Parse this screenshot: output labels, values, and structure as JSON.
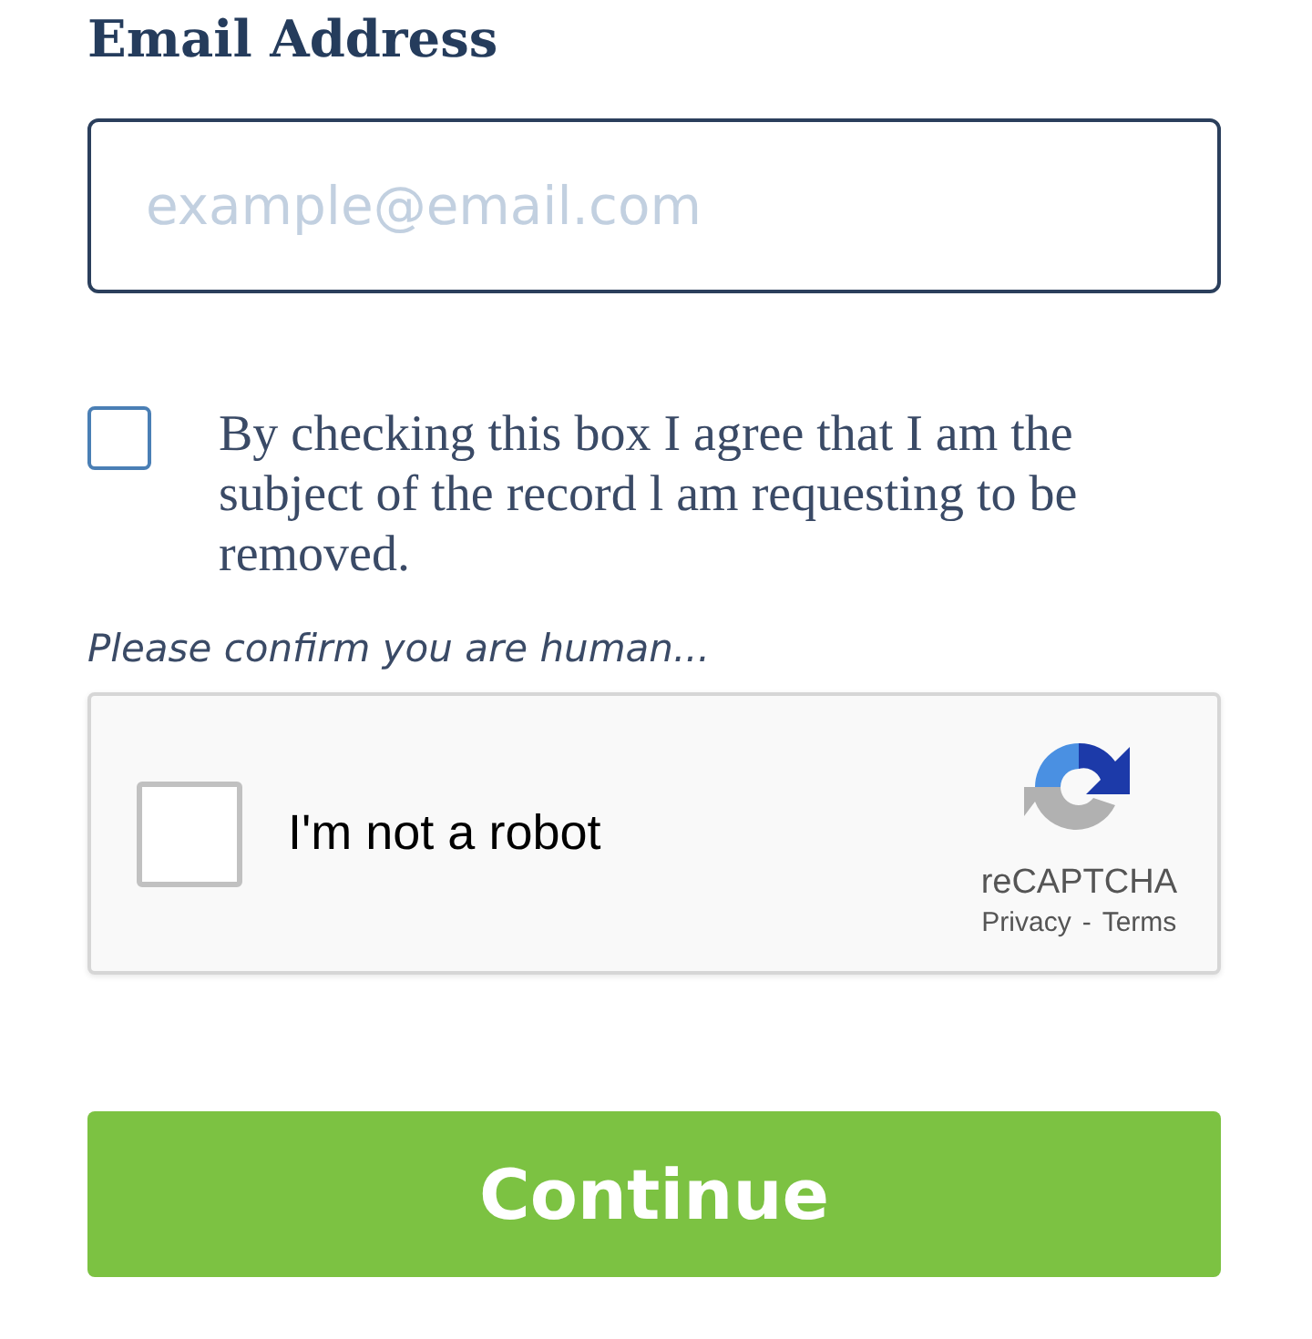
{
  "email": {
    "label": "Email Address",
    "placeholder": "example@email.com"
  },
  "consent": {
    "checked": false,
    "text": "By checking this box I agree that I am the subject of the record l am requesting to be removed."
  },
  "captcha_prompt": "Please confirm you are human...",
  "recaptcha": {
    "checked": false,
    "label": "I'm not a robot",
    "brand": "reCAPTCHA",
    "links": [
      "Privacy",
      "Terms"
    ],
    "separator": "-"
  },
  "submit": {
    "label": "Continue"
  }
}
